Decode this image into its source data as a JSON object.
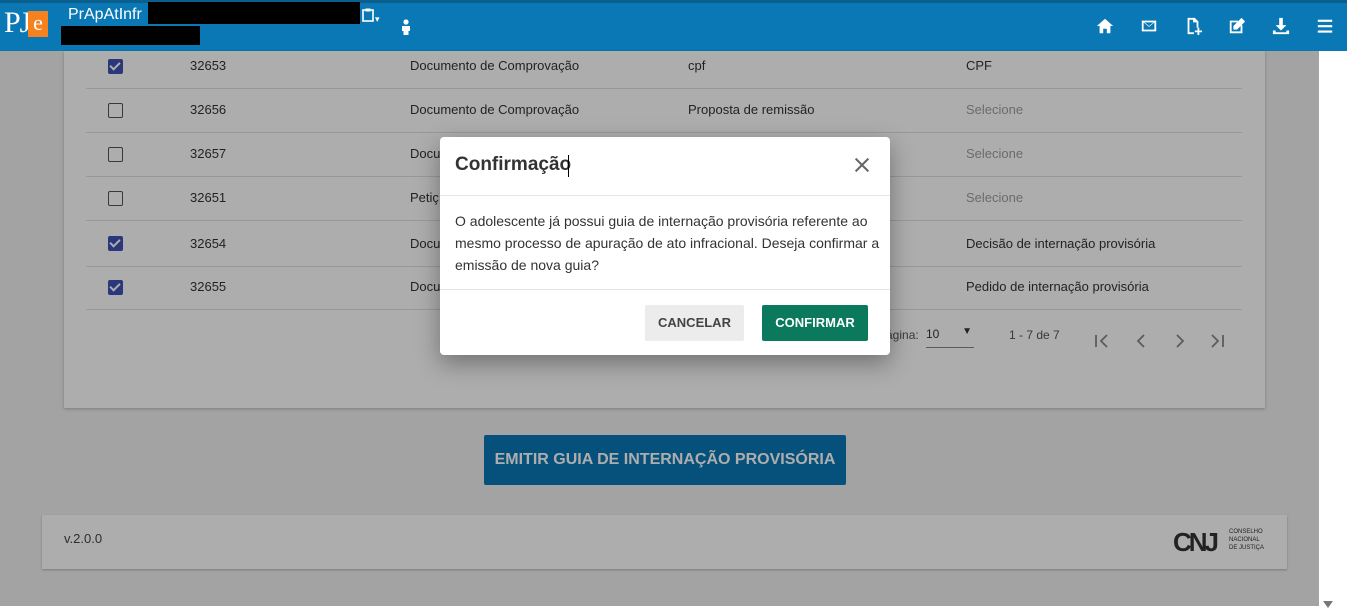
{
  "header": {
    "app_name": "PrApAtInfr",
    "logo_text": "PJ",
    "logo_accent": "e",
    "icons": [
      "home-icon",
      "mail-icon",
      "add-document-icon",
      "edit-icon",
      "download-icon",
      "menu-icon"
    ]
  },
  "table": {
    "rows": [
      {
        "checked": true,
        "id": "32653",
        "type": "Documento de Comprovação",
        "description": "cpf",
        "classification": "CPF"
      },
      {
        "checked": false,
        "id": "32656",
        "type": "Documento de Comprovação",
        "description": "Proposta de remissão",
        "classification": "Selecione"
      },
      {
        "checked": false,
        "id": "32657",
        "type": "Docu",
        "description": "",
        "classification": "Selecione"
      },
      {
        "checked": false,
        "id": "32651",
        "type": "Petiç",
        "description": "",
        "classification": "Selecione"
      },
      {
        "checked": true,
        "id": "32654",
        "type": "Docu",
        "description": "",
        "classification": "Decisão de internação provisória"
      },
      {
        "checked": true,
        "id": "32655",
        "type": "Docu",
        "description": "",
        "classification": "Pedido de internação provisória"
      }
    ]
  },
  "pager": {
    "items_label": "ágina:",
    "page_size": "10",
    "range": "1 - 7 de 7"
  },
  "actions": {
    "emit_label": "EMITIR GUIA DE INTERNAÇÃO PROVISÓRIA"
  },
  "footer": {
    "version": "v.2.0.0",
    "logo_mark": "CNJ",
    "logo_text": "CONSELHO NACIONAL DE JUSTIÇA"
  },
  "modal": {
    "title": "Confirmação",
    "body": "O adolescente já possui guia de internação provisória referente ao mesmo processo de apuração de ato infracional. Deseja confirmar a emissão de nova guia?",
    "cancel_label": "CANCELAR",
    "confirm_label": "CONFIRMAR"
  },
  "colors": {
    "header_bg": "#0a78b5",
    "confirm_bg": "#0b7a5c",
    "checkbox_checked": "#3f51b5",
    "logo_accent": "#f5821f"
  }
}
